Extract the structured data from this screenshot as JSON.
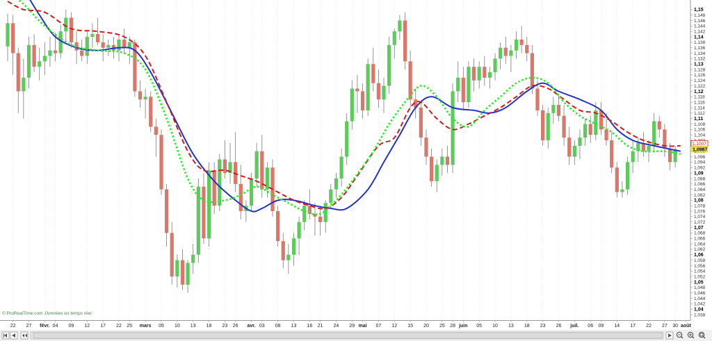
{
  "watermark": {
    "brand": "© ProRealTime.com",
    "note": "Données en temps réel"
  },
  "price_badges": {
    "ma_label": "1,1007",
    "last_price": "1,0987"
  },
  "colors": {
    "up": "#5ccb5c",
    "down": "#d9776b",
    "blue_ma": "#2233cc",
    "red_ma": "#d11a1a",
    "green_ma": "#22ee22",
    "badge_red": "#d11a1a",
    "badge_yellow": "#f5e62a"
  },
  "chart_data": {
    "type": "candlestick",
    "ylim": [
      1.037,
      1.1525
    ],
    "y_ticks": [
      "1,15",
      "1,148",
      "1,146",
      "1,144",
      "1,142",
      "1,14",
      "1,138",
      "1,136",
      "1,134",
      "1,132",
      "1,13",
      "1,128",
      "1,126",
      "1,124",
      "1,122",
      "1,12",
      "1,118",
      "1,116",
      "1,114",
      "1,112",
      "1,11",
      "1,108",
      "1,106",
      "1,104",
      "1,102",
      "1,1",
      "1,098",
      "1,096",
      "1,094",
      "1,092",
      "1,09",
      "1,088",
      "1,086",
      "1,084",
      "1,082",
      "1,08",
      "1,078",
      "1,076",
      "1,074",
      "1,072",
      "1,07",
      "1,068",
      "1,066",
      "1,064",
      "1,062",
      "1,06",
      "1,058",
      "1,056",
      "1,054",
      "1,052",
      "1,05",
      "1,048",
      "1,046",
      "1,044",
      "1,042",
      "1,04",
      "1,038"
    ],
    "x_labels": [
      {
        "label": "22",
        "i": 1,
        "bold": false
      },
      {
        "label": "27",
        "i": 4,
        "bold": false
      },
      {
        "label": "févr.",
        "i": 7,
        "bold": true
      },
      {
        "label": "04",
        "i": 9,
        "bold": false
      },
      {
        "label": "09",
        "i": 12,
        "bold": false
      },
      {
        "label": "12",
        "i": 15,
        "bold": false
      },
      {
        "label": "17",
        "i": 18,
        "bold": false
      },
      {
        "label": "22",
        "i": 21,
        "bold": false
      },
      {
        "label": "25",
        "i": 23,
        "bold": false
      },
      {
        "label": "mars",
        "i": 26,
        "bold": true
      },
      {
        "label": "05",
        "i": 29,
        "bold": false
      },
      {
        "label": "10",
        "i": 32,
        "bold": false
      },
      {
        "label": "13",
        "i": 35,
        "bold": false
      },
      {
        "label": "18",
        "i": 38,
        "bold": false
      },
      {
        "label": "23",
        "i": 41,
        "bold": false
      },
      {
        "label": "26",
        "i": 43,
        "bold": false
      },
      {
        "label": "avr.",
        "i": 46,
        "bold": true
      },
      {
        "label": "03",
        "i": 48,
        "bold": false
      },
      {
        "label": "08",
        "i": 51,
        "bold": false
      },
      {
        "label": "13",
        "i": 54,
        "bold": false
      },
      {
        "label": "16",
        "i": 57,
        "bold": false
      },
      {
        "label": "21",
        "i": 59,
        "bold": false
      },
      {
        "label": "24",
        "i": 62,
        "bold": false
      },
      {
        "label": "29",
        "i": 65,
        "bold": false
      },
      {
        "label": "mai",
        "i": 67,
        "bold": true
      },
      {
        "label": "07",
        "i": 70,
        "bold": false
      },
      {
        "label": "12",
        "i": 73,
        "bold": false
      },
      {
        "label": "15",
        "i": 76,
        "bold": false
      },
      {
        "label": "20",
        "i": 79,
        "bold": false
      },
      {
        "label": "25",
        "i": 82,
        "bold": false
      },
      {
        "label": "28",
        "i": 84,
        "bold": false
      },
      {
        "label": "juin",
        "i": 86,
        "bold": true
      },
      {
        "label": "05",
        "i": 89,
        "bold": false
      },
      {
        "label": "10",
        "i": 92,
        "bold": false
      },
      {
        "label": "13",
        "i": 95,
        "bold": false
      },
      {
        "label": "18",
        "i": 98,
        "bold": false
      },
      {
        "label": "23",
        "i": 101,
        "bold": false
      },
      {
        "label": "26",
        "i": 104,
        "bold": false
      },
      {
        "label": "juil.",
        "i": 107,
        "bold": true
      },
      {
        "label": "06",
        "i": 110,
        "bold": false
      },
      {
        "label": "09",
        "i": 112,
        "bold": false
      },
      {
        "label": "14",
        "i": 115,
        "bold": false
      },
      {
        "label": "17",
        "i": 118,
        "bold": false
      },
      {
        "label": "22",
        "i": 121,
        "bold": false
      },
      {
        "label": "27",
        "i": 124,
        "bold": false
      },
      {
        "label": "30",
        "i": 126,
        "bold": false
      },
      {
        "label": "août",
        "i": 128,
        "bold": true
      }
    ],
    "candles": [
      [
        1.1365,
        1.1485,
        1.131,
        1.145
      ],
      [
        1.145,
        1.148,
        1.126,
        1.134
      ],
      [
        1.134,
        1.136,
        1.112,
        1.12
      ],
      [
        1.12,
        1.132,
        1.11,
        1.125
      ],
      [
        1.125,
        1.14,
        1.121,
        1.137
      ],
      [
        1.137,
        1.141,
        1.127,
        1.129
      ],
      [
        1.129,
        1.136,
        1.124,
        1.131
      ],
      [
        1.131,
        1.138,
        1.126,
        1.133
      ],
      [
        1.133,
        1.14,
        1.129,
        1.135
      ],
      [
        1.135,
        1.1415,
        1.131,
        1.134
      ],
      [
        1.134,
        1.1445,
        1.132,
        1.142
      ],
      [
        1.142,
        1.15,
        1.138,
        1.147
      ],
      [
        1.147,
        1.149,
        1.136,
        1.138
      ],
      [
        1.138,
        1.142,
        1.13,
        1.135
      ],
      [
        1.135,
        1.139,
        1.131,
        1.133
      ],
      [
        1.133,
        1.142,
        1.13,
        1.14
      ],
      [
        1.14,
        1.145,
        1.136,
        1.141
      ],
      [
        1.141,
        1.147,
        1.137,
        1.138
      ],
      [
        1.138,
        1.141,
        1.131,
        1.136
      ],
      [
        1.136,
        1.139,
        1.133,
        1.137
      ],
      [
        1.137,
        1.14,
        1.132,
        1.135
      ],
      [
        1.135,
        1.141,
        1.131,
        1.139
      ],
      [
        1.139,
        1.143,
        1.134,
        1.136
      ],
      [
        1.136,
        1.14,
        1.13,
        1.138
      ],
      [
        1.138,
        1.139,
        1.118,
        1.12
      ],
      [
        1.12,
        1.124,
        1.114,
        1.117
      ],
      [
        1.117,
        1.121,
        1.11,
        1.118
      ],
      [
        1.118,
        1.12,
        1.105,
        1.107
      ],
      [
        1.107,
        1.11,
        1.096,
        1.104
      ],
      [
        1.104,
        1.106,
        1.082,
        1.084
      ],
      [
        1.084,
        1.086,
        1.063,
        1.068
      ],
      [
        1.068,
        1.072,
        1.049,
        1.052
      ],
      [
        1.052,
        1.06,
        1.048,
        1.058
      ],
      [
        1.058,
        1.062,
        1.047,
        1.049
      ],
      [
        1.049,
        1.058,
        1.046,
        1.057
      ],
      [
        1.057,
        1.064,
        1.053,
        1.06
      ],
      [
        1.06,
        1.088,
        1.057,
        1.085
      ],
      [
        1.085,
        1.09,
        1.064,
        1.066
      ],
      [
        1.066,
        1.094,
        1.063,
        1.091
      ],
      [
        1.091,
        1.094,
        1.075,
        1.078
      ],
      [
        1.078,
        1.097,
        1.076,
        1.095
      ],
      [
        1.095,
        1.102,
        1.088,
        1.09
      ],
      [
        1.09,
        1.101,
        1.086,
        1.094
      ],
      [
        1.094,
        1.105,
        1.083,
        1.086
      ],
      [
        1.086,
        1.093,
        1.073,
        1.076
      ],
      [
        1.076,
        1.08,
        1.072,
        1.078
      ],
      [
        1.078,
        1.09,
        1.076,
        1.088
      ],
      [
        1.088,
        1.101,
        1.085,
        1.098
      ],
      [
        1.098,
        1.104,
        1.081,
        1.084
      ],
      [
        1.084,
        1.094,
        1.081,
        1.092
      ],
      [
        1.092,
        1.095,
        1.074,
        1.076
      ],
      [
        1.076,
        1.078,
        1.063,
        1.065
      ],
      [
        1.065,
        1.068,
        1.055,
        1.058
      ],
      [
        1.058,
        1.064,
        1.053,
        1.06
      ],
      [
        1.06,
        1.068,
        1.056,
        1.066
      ],
      [
        1.066,
        1.074,
        1.06,
        1.072
      ],
      [
        1.072,
        1.08,
        1.069,
        1.078
      ],
      [
        1.078,
        1.084,
        1.073,
        1.075
      ],
      [
        1.075,
        1.079,
        1.067,
        1.074
      ],
      [
        1.074,
        1.078,
        1.067,
        1.072
      ],
      [
        1.072,
        1.08,
        1.068,
        1.079
      ],
      [
        1.079,
        1.086,
        1.077,
        1.084
      ],
      [
        1.084,
        1.09,
        1.081,
        1.088
      ],
      [
        1.088,
        1.099,
        1.085,
        1.096
      ],
      [
        1.096,
        1.112,
        1.093,
        1.109
      ],
      [
        1.109,
        1.124,
        1.106,
        1.121
      ],
      [
        1.121,
        1.126,
        1.112,
        1.12
      ],
      [
        1.12,
        1.123,
        1.11,
        1.113
      ],
      [
        1.113,
        1.132,
        1.111,
        1.13
      ],
      [
        1.13,
        1.136,
        1.12,
        1.123
      ],
      [
        1.123,
        1.128,
        1.114,
        1.117
      ],
      [
        1.117,
        1.125,
        1.112,
        1.122
      ],
      [
        1.122,
        1.14,
        1.119,
        1.137
      ],
      [
        1.137,
        1.143,
        1.132,
        1.142
      ],
      [
        1.142,
        1.148,
        1.139,
        1.146
      ],
      [
        1.146,
        1.149,
        1.128,
        1.131
      ],
      [
        1.131,
        1.135,
        1.114,
        1.117
      ],
      [
        1.117,
        1.121,
        1.11,
        1.114
      ],
      [
        1.114,
        1.116,
        1.1,
        1.103
      ],
      [
        1.103,
        1.106,
        1.093,
        1.096
      ],
      [
        1.096,
        1.099,
        1.085,
        1.087
      ],
      [
        1.087,
        1.095,
        1.083,
        1.093
      ],
      [
        1.093,
        1.099,
        1.089,
        1.096
      ],
      [
        1.096,
        1.1,
        1.09,
        1.093
      ],
      [
        1.093,
        1.123,
        1.09,
        1.12
      ],
      [
        1.12,
        1.131,
        1.116,
        1.125
      ],
      [
        1.125,
        1.129,
        1.113,
        1.116
      ],
      [
        1.116,
        1.131,
        1.114,
        1.129
      ],
      [
        1.129,
        1.132,
        1.12,
        1.124
      ],
      [
        1.124,
        1.131,
        1.121,
        1.129
      ],
      [
        1.129,
        1.133,
        1.122,
        1.125
      ],
      [
        1.125,
        1.129,
        1.121,
        1.127
      ],
      [
        1.127,
        1.134,
        1.124,
        1.132
      ],
      [
        1.132,
        1.138,
        1.128,
        1.136
      ],
      [
        1.136,
        1.14,
        1.13,
        1.133
      ],
      [
        1.133,
        1.137,
        1.127,
        1.135
      ],
      [
        1.135,
        1.142,
        1.132,
        1.139
      ],
      [
        1.139,
        1.144,
        1.134,
        1.137
      ],
      [
        1.137,
        1.14,
        1.131,
        1.134
      ],
      [
        1.134,
        1.137,
        1.119,
        1.121
      ],
      [
        1.121,
        1.124,
        1.111,
        1.113
      ],
      [
        1.113,
        1.115,
        1.1,
        1.102
      ],
      [
        1.102,
        1.114,
        1.099,
        1.112
      ],
      [
        1.112,
        1.118,
        1.108,
        1.115
      ],
      [
        1.115,
        1.119,
        1.109,
        1.111
      ],
      [
        1.111,
        1.115,
        1.1,
        1.103
      ],
      [
        1.103,
        1.107,
        1.093,
        1.096
      ],
      [
        1.096,
        1.102,
        1.093,
        1.1
      ],
      [
        1.1,
        1.106,
        1.095,
        1.103
      ],
      [
        1.103,
        1.11,
        1.1,
        1.108
      ],
      [
        1.108,
        1.111,
        1.101,
        1.104
      ],
      [
        1.104,
        1.116,
        1.102,
        1.113
      ],
      [
        1.113,
        1.116,
        1.104,
        1.106
      ],
      [
        1.106,
        1.112,
        1.1,
        1.102
      ],
      [
        1.102,
        1.105,
        1.09,
        1.092
      ],
      [
        1.092,
        1.094,
        1.081,
        1.083
      ],
      [
        1.083,
        1.087,
        1.081,
        1.084
      ],
      [
        1.084,
        1.096,
        1.082,
        1.094
      ],
      [
        1.094,
        1.102,
        1.09,
        1.098
      ],
      [
        1.098,
        1.103,
        1.094,
        1.101
      ],
      [
        1.101,
        1.105,
        1.096,
        1.098
      ],
      [
        1.098,
        1.102,
        1.094,
        1.1
      ],
      [
        1.1,
        1.112,
        1.098,
        1.109
      ],
      [
        1.109,
        1.111,
        1.103,
        1.106
      ],
      [
        1.106,
        1.108,
        1.096,
        1.099
      ],
      [
        1.099,
        1.101,
        1.091,
        1.094
      ],
      [
        1.094,
        1.1,
        1.092,
        1.0987
      ]
    ],
    "ma_red": [
      [
        0,
        1.153
      ],
      [
        3,
        1.15
      ],
      [
        7,
        1.149
      ],
      [
        12,
        1.143
      ],
      [
        17,
        1.142
      ],
      [
        22,
        1.14
      ],
      [
        26,
        1.133
      ],
      [
        30,
        1.116
      ],
      [
        34,
        1.098
      ],
      [
        37,
        1.091
      ],
      [
        41,
        1.091
      ],
      [
        44,
        1.089
      ],
      [
        47,
        1.087
      ],
      [
        51,
        1.083
      ],
      [
        54,
        1.08
      ],
      [
        57,
        1.078
      ],
      [
        60,
        1.077
      ],
      [
        63,
        1.081
      ],
      [
        66,
        1.089
      ],
      [
        70,
        1.1
      ],
      [
        73,
        1.103
      ],
      [
        76,
        1.114
      ],
      [
        78,
        1.116
      ],
      [
        81,
        1.11
      ],
      [
        84,
        1.106
      ],
      [
        87,
        1.108
      ],
      [
        90,
        1.111
      ],
      [
        93,
        1.114
      ],
      [
        96,
        1.118
      ],
      [
        99,
        1.122
      ],
      [
        102,
        1.121
      ],
      [
        105,
        1.117
      ],
      [
        108,
        1.113
      ],
      [
        111,
        1.112
      ],
      [
        114,
        1.109
      ],
      [
        117,
        1.105
      ],
      [
        120,
        1.102
      ],
      [
        124,
        1.1
      ],
      [
        127,
        1.1
      ]
    ],
    "ma_green": [
      [
        0,
        1.157
      ],
      [
        3,
        1.152
      ],
      [
        7,
        1.144
      ],
      [
        12,
        1.137
      ],
      [
        17,
        1.135
      ],
      [
        22,
        1.134
      ],
      [
        26,
        1.128
      ],
      [
        30,
        1.11
      ],
      [
        34,
        1.088
      ],
      [
        37,
        1.08
      ],
      [
        41,
        1.08
      ],
      [
        44,
        1.082
      ],
      [
        47,
        1.085
      ],
      [
        50,
        1.082
      ],
      [
        53,
        1.079
      ],
      [
        56,
        1.076
      ],
      [
        59,
        1.075
      ],
      [
        62,
        1.08
      ],
      [
        65,
        1.087
      ],
      [
        69,
        1.098
      ],
      [
        72,
        1.108
      ],
      [
        75,
        1.116
      ],
      [
        78,
        1.122
      ],
      [
        81,
        1.118
      ],
      [
        84,
        1.11
      ],
      [
        87,
        1.107
      ],
      [
        90,
        1.113
      ],
      [
        93,
        1.118
      ],
      [
        96,
        1.123
      ],
      [
        99,
        1.125
      ],
      [
        102,
        1.123
      ],
      [
        105,
        1.116
      ],
      [
        108,
        1.111
      ],
      [
        111,
        1.108
      ],
      [
        114,
        1.105
      ],
      [
        117,
        1.1
      ],
      [
        120,
        1.098
      ],
      [
        124,
        1.098
      ],
      [
        127,
        1.097
      ]
    ],
    "ma_blue": [
      [
        0,
        1.162
      ],
      [
        3,
        1.157
      ],
      [
        6,
        1.148
      ],
      [
        9,
        1.14
      ],
      [
        13,
        1.136
      ],
      [
        17,
        1.135
      ],
      [
        21,
        1.136
      ],
      [
        24,
        1.135
      ],
      [
        27,
        1.127
      ],
      [
        31,
        1.112
      ],
      [
        35,
        1.097
      ],
      [
        39,
        1.087
      ],
      [
        43,
        1.08
      ],
      [
        46,
        1.076
      ],
      [
        48,
        1.077
      ],
      [
        51,
        1.08
      ],
      [
        54,
        1.08
      ],
      [
        58,
        1.078
      ],
      [
        61,
        1.077
      ],
      [
        64,
        1.077
      ],
      [
        68,
        1.084
      ],
      [
        71,
        1.094
      ],
      [
        74,
        1.104
      ],
      [
        77,
        1.114
      ],
      [
        80,
        1.118
      ],
      [
        84,
        1.114
      ],
      [
        88,
        1.113
      ],
      [
        91,
        1.112
      ],
      [
        94,
        1.114
      ],
      [
        98,
        1.12
      ],
      [
        101,
        1.123
      ],
      [
        104,
        1.12
      ],
      [
        108,
        1.117
      ],
      [
        112,
        1.113
      ],
      [
        115,
        1.106
      ],
      [
        118,
        1.102
      ],
      [
        122,
        1.1
      ],
      [
        127,
        1.098
      ]
    ]
  }
}
